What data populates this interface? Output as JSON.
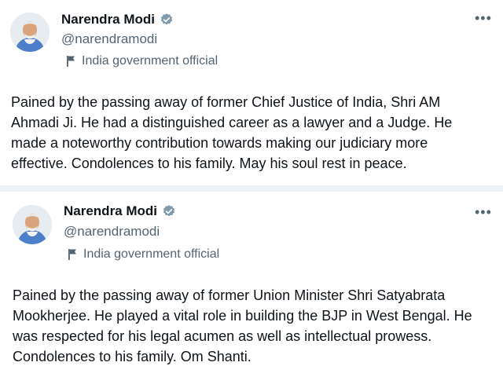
{
  "tweets": [
    {
      "author_name": "Narendra Modi",
      "handle": "@narendramodi",
      "label": "India government official",
      "text": "Pained by the passing away of former Chief Justice of India, Shri AM\nAhmadi Ji. He had a distinguished career as a lawyer and a Judge. He\nmade a noteworthy contribution towards making our judiciary more\neffective. Condolences to his family. May his soul rest in peace.",
      "more_icon": "more-horizontal-icon"
    },
    {
      "author_name": "Narendra Modi",
      "handle": "@narendramodi",
      "label": "India government official",
      "text": "Pained by the passing away of former Union Minister Shri Satyabrata\nMookherjee. He played a vital role in building the BJP in West Bengal. He\nwas respected for his legal acumen as well as intellectual prowess.\nCondolences to his family. Om Shanti.",
      "more_icon": "more-horizontal-icon"
    }
  ],
  "colors": {
    "text_primary": "#0f1419",
    "text_secondary": "#536471",
    "verified_badge": "#829aab",
    "divider": "#eef1f3"
  },
  "icons": {
    "verified": "verified-badge-icon",
    "government_label": "flag-icon",
    "more": "ellipsis-icon"
  }
}
